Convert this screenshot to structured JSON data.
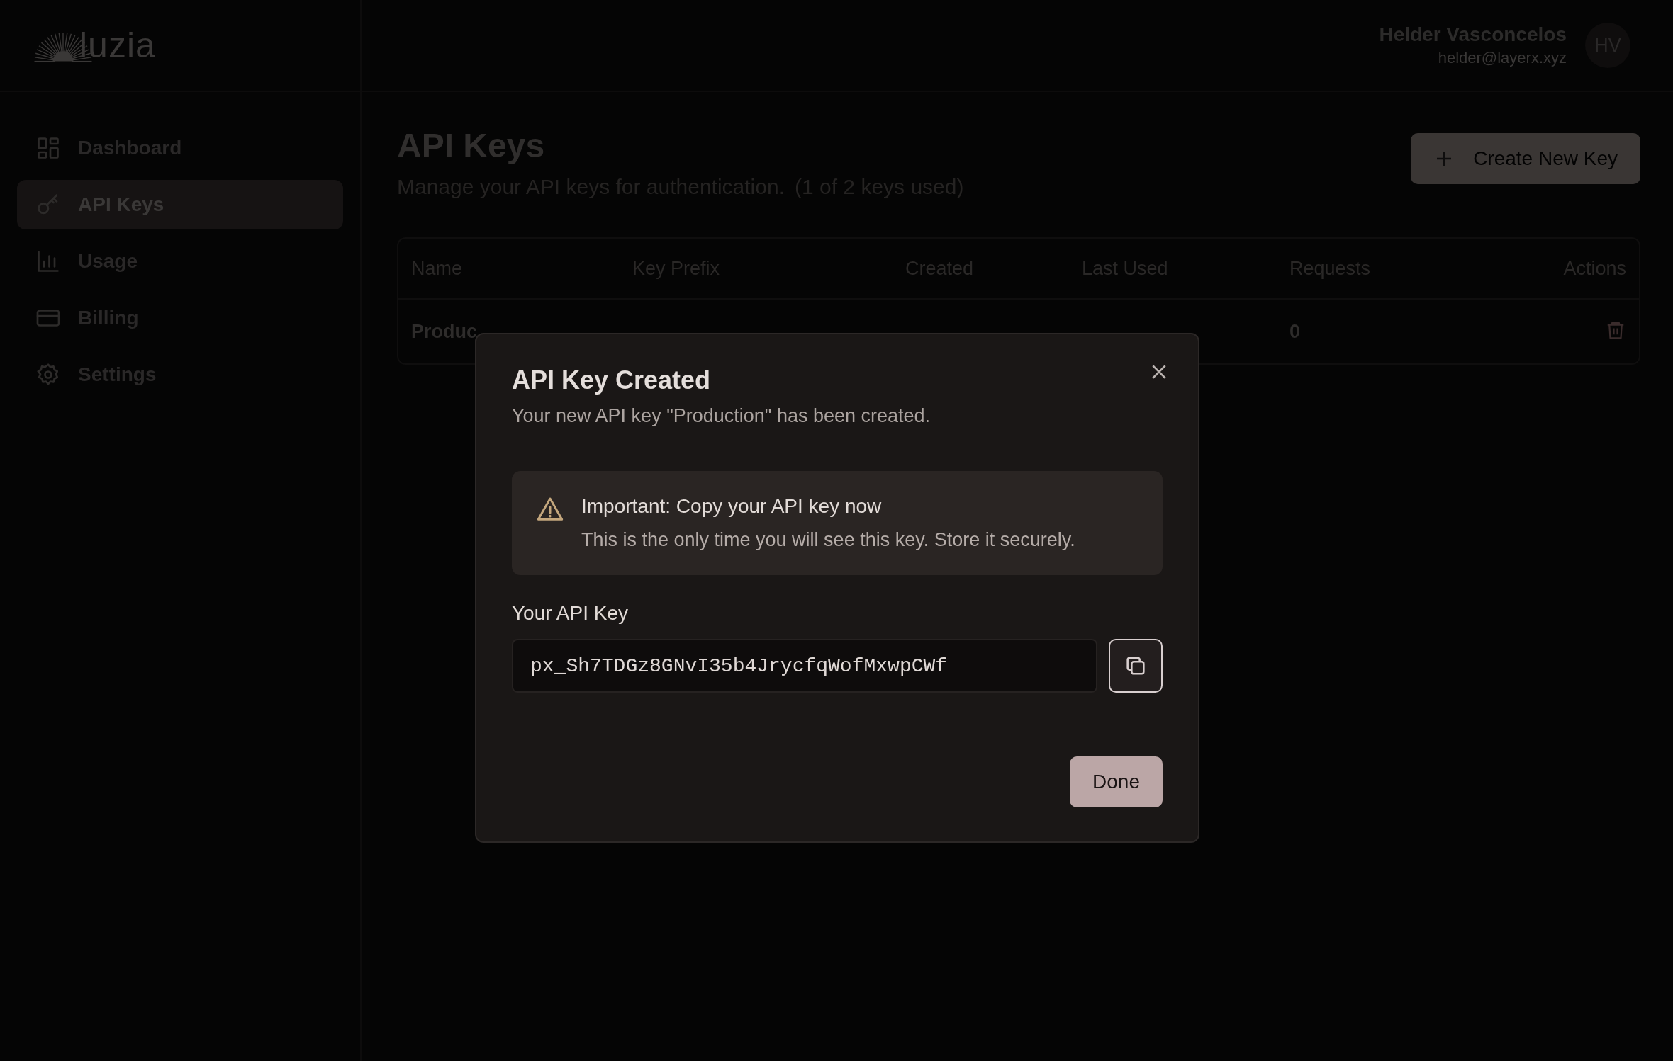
{
  "brand": {
    "logo_text": "luzia"
  },
  "user": {
    "name": "Helder Vasconcelos",
    "email": "helder@layerx.xyz",
    "initials": "HV"
  },
  "sidebar": {
    "items": [
      {
        "label": "Dashboard",
        "selected": false
      },
      {
        "label": "API Keys",
        "selected": true
      },
      {
        "label": "Usage",
        "selected": false
      },
      {
        "label": "Billing",
        "selected": false
      },
      {
        "label": "Settings",
        "selected": false
      }
    ]
  },
  "page": {
    "title": "API Keys",
    "subtitle": "Manage your API keys for authentication.",
    "quota": "(1 of 2 keys used)",
    "create_button": "Create New Key"
  },
  "table": {
    "columns": [
      "Name",
      "Key Prefix",
      "Created",
      "Last Used",
      "Requests",
      "Actions"
    ],
    "rows": [
      {
        "name": "Produc",
        "requests": "0"
      }
    ]
  },
  "dialog": {
    "title": "API Key Created",
    "description": "Your new API key \"Production\" has been created.",
    "alert": {
      "title": "Important: Copy your API key now",
      "text": "This is the only time you will see this key. Store it securely."
    },
    "field_label": "Your API Key",
    "key_value": "px_Sh7TDGz8GNvI35b4JrycfqWofMxwpCWf",
    "done_button": "Done"
  }
}
